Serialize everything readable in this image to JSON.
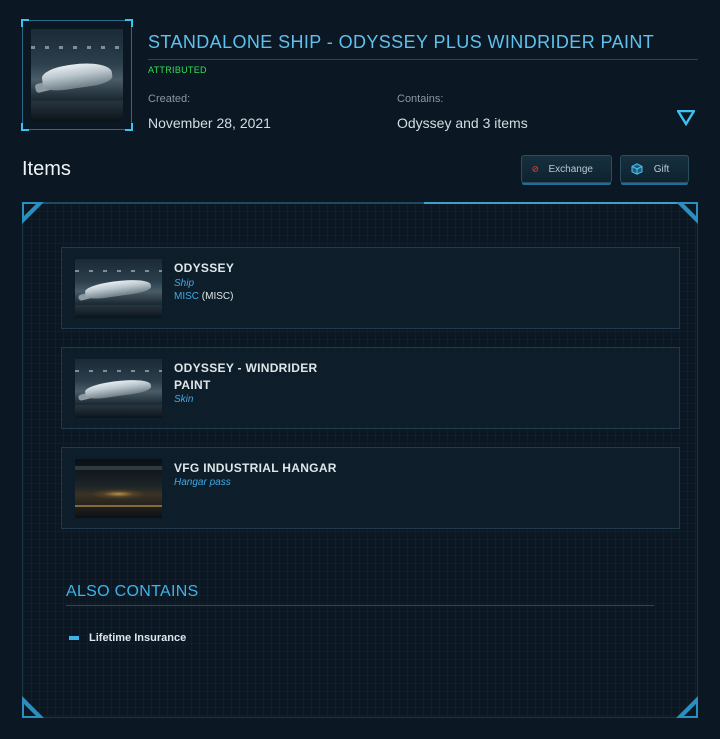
{
  "header": {
    "title": "STANDALONE SHIP - ODYSSEY PLUS WINDRIDER PAINT",
    "status": "ATTRIBUTED",
    "created_label": "Created:",
    "created_value": "November 28, 2021",
    "contains_label": "Contains:",
    "contains_value": "Odyssey and 3 items",
    "collapse_icon": "triangle-down-icon"
  },
  "items_section": {
    "heading": "Items",
    "exchange_label": "Exchange",
    "gift_label": "Gift",
    "exchange_icon": "no-entry-icon",
    "gift_icon": "cube-icon"
  },
  "items": [
    {
      "name": "ODYSSEY",
      "type": "Ship",
      "manufacturer": "MISC",
      "manufacturer_code": "(MISC)"
    },
    {
      "name_line1": "ODYSSEY - WINDRIDER",
      "name_line2": "PAINT",
      "type": "Skin"
    },
    {
      "name": "VFG INDUSTRIAL HANGAR",
      "type": "Hangar pass"
    }
  ],
  "also_contains": {
    "heading": "ALSO CONTAINS",
    "items": [
      "Lifetime Insurance"
    ]
  },
  "colors": {
    "accent": "#3fb4e8",
    "title": "#5fc2ee",
    "attributed": "#2ee05a",
    "background": "#0b1722"
  }
}
